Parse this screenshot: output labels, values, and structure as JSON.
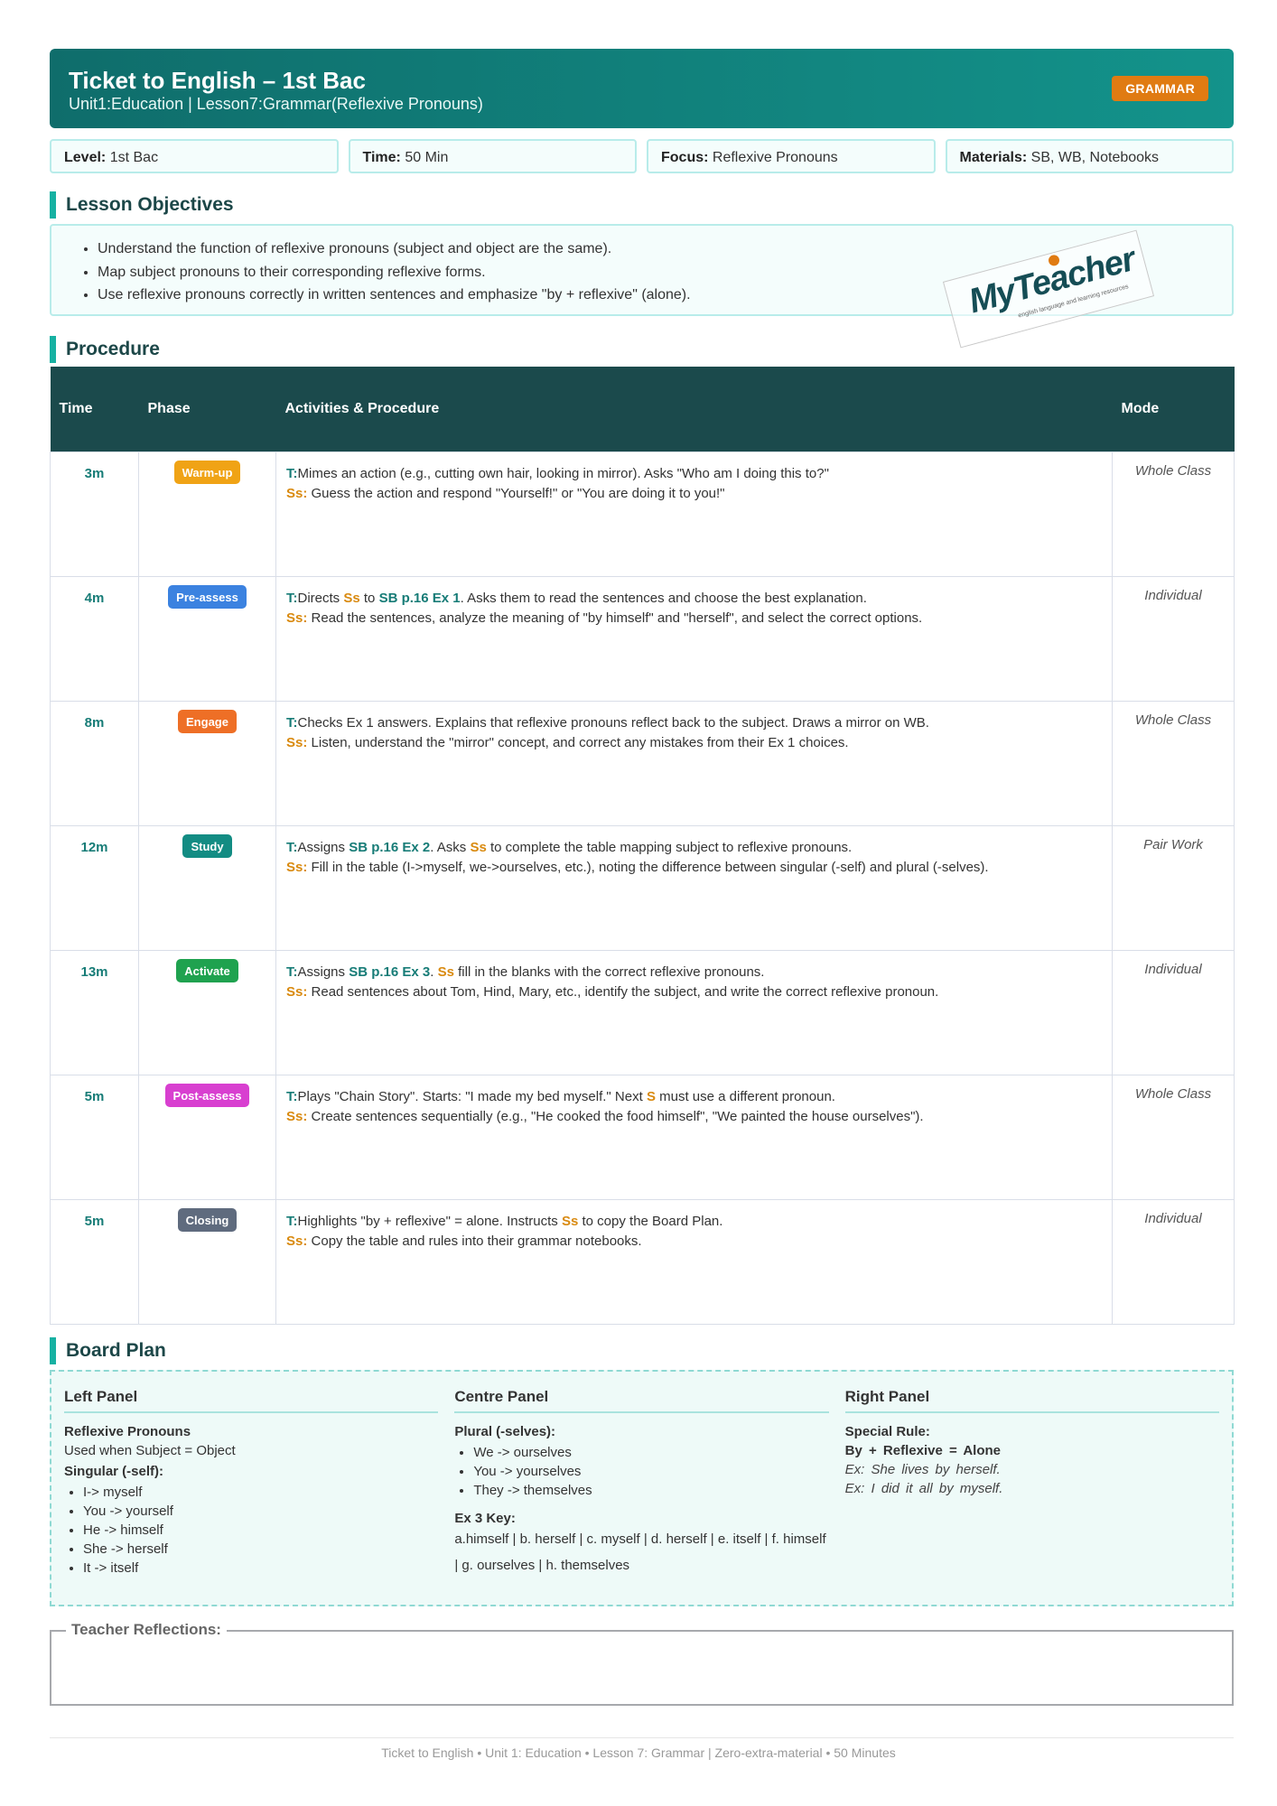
{
  "header": {
    "title": "Ticket to English – 1st Bac",
    "subtitle": "Unit1:Education | Lesson7:Grammar(Reflexive Pronouns)",
    "badge": "GRAMMAR"
  },
  "info": [
    {
      "label": "Level:",
      "value": "1st Bac"
    },
    {
      "label": "Time:",
      "value": "50 Min"
    },
    {
      "label": "Focus:",
      "value": "Reflexive Pronouns"
    },
    {
      "label": "Materials:",
      "value": "SB, WB, Notebooks"
    }
  ],
  "objectives": {
    "title": "Lesson Objectives",
    "items": [
      "Understand the function of reflexive pronouns (subject and object are the same).",
      "Map subject pronouns to their corresponding reflexive forms.",
      "Use reflexive pronouns correctly in written sentences and emphasize \"by + reflexive\" (alone)."
    ]
  },
  "logo": {
    "text": "MyTeacher",
    "tagline": "english language and learning resources"
  },
  "procedure": {
    "title": "Procedure",
    "headers": [
      "Time",
      "Phase",
      "Activities & Procedure",
      "Mode"
    ],
    "t_label": "T:",
    "ss_label": "Ss:",
    "rows": [
      {
        "time": "3m",
        "phase": "Warm-up",
        "color": "#f0a315",
        "t": "Mimes an action (e.g., cutting own hair, looking in mirror). Asks \"Who am I doing this to?\"",
        "ss": "Guess the action and respond \"Yourself!\" or \"You are doing it to you!\"",
        "mode": "Whole Class"
      },
      {
        "time": "4m",
        "phase": "Pre-assess",
        "color": "#3b82e0",
        "t_parts": [
          "Directs ",
          "Ss",
          " to ",
          "SB p.16 Ex 1",
          ". Asks them to read the sentences and choose the best explanation."
        ],
        "ss": "Read the sentences, analyze the meaning of \"by himself\" and \"herself\", and select the correct options.",
        "mode": "Individual"
      },
      {
        "time": "8m",
        "phase": "Engage",
        "color": "#ee6f26",
        "t": "Checks Ex 1 answers. Explains that reflexive pronouns reflect back to the subject. Draws a mirror on WB.",
        "ss": "Listen, understand the \"mirror\" concept, and correct any mistakes from their Ex 1 choices.",
        "mode": "Whole Class"
      },
      {
        "time": "12m",
        "phase": "Study",
        "color": "#128c83",
        "t_parts": [
          "Assigns ",
          "SB p.16 Ex 2",
          ". Asks ",
          "Ss",
          " to complete the table mapping subject to reflexive pronouns."
        ],
        "ss": "Fill in the table (I->myself, we->ourselves, etc.), noting the difference between singular (-self) and plural (-selves).",
        "mode": "Pair Work"
      },
      {
        "time": "13m",
        "phase": "Activate",
        "color": "#1fa24f",
        "t_parts": [
          "Assigns ",
          "SB p.16 Ex 3",
          ". ",
          "Ss",
          " fill in the blanks with the correct reflexive pronouns."
        ],
        "ss": "Read sentences about Tom, Hind, Mary, etc., identify the subject, and write the correct reflexive pronoun.",
        "mode": "Individual"
      },
      {
        "time": "5m",
        "phase": "Post-assess",
        "color": "#d83fd0",
        "t_parts": [
          "Plays \"Chain Story\". Starts: \"I made my bed myself.\" Next ",
          "S",
          " must use a different pronoun."
        ],
        "ss": "Create sentences sequentially (e.g., \"He cooked the food himself\", \"We painted the house ourselves\").",
        "mode": "Whole Class"
      },
      {
        "time": "5m",
        "phase": "Closing",
        "color": "#5f6b7e",
        "t_parts": [
          "Highlights \"by + reflexive\" = alone. Instructs ",
          "Ss",
          " to copy the Board Plan."
        ],
        "ss": "Copy the table and rules into their grammar notebooks.",
        "mode": "Individual"
      }
    ]
  },
  "board": {
    "title": "Board Plan",
    "left": {
      "title": "Left Panel",
      "heading": "Reflexive Pronouns",
      "text": "Used when Subject = Object",
      "sub": "Singular (-self):",
      "items": [
        "I-> myself",
        "You -> yourself",
        "He -> himself",
        "She -> herself",
        "It -> itself"
      ]
    },
    "centre": {
      "title": "Centre Panel",
      "sub": "Plural (-selves):",
      "items": [
        "We -> ourselves",
        "You -> yourselves",
        "They -> themselves"
      ],
      "key_title": "Ex 3 Key:",
      "key_text": "a.himself | b. herself | c. myself | d. herself | e. itself | f. himself | g. ourselves | h. themselves"
    },
    "right": {
      "title": "Right Panel",
      "sub": "Special Rule:",
      "rule": "By + Reflexive = Alone",
      "ex1": "Ex: She lives by herself.",
      "ex2": "Ex: I did it all by myself."
    }
  },
  "reflections": {
    "label": "Teacher Reflections:"
  },
  "footer": "Ticket to English • Unit 1: Education • Lesson 7: Grammar | Zero-extra-material • 50 Minutes"
}
